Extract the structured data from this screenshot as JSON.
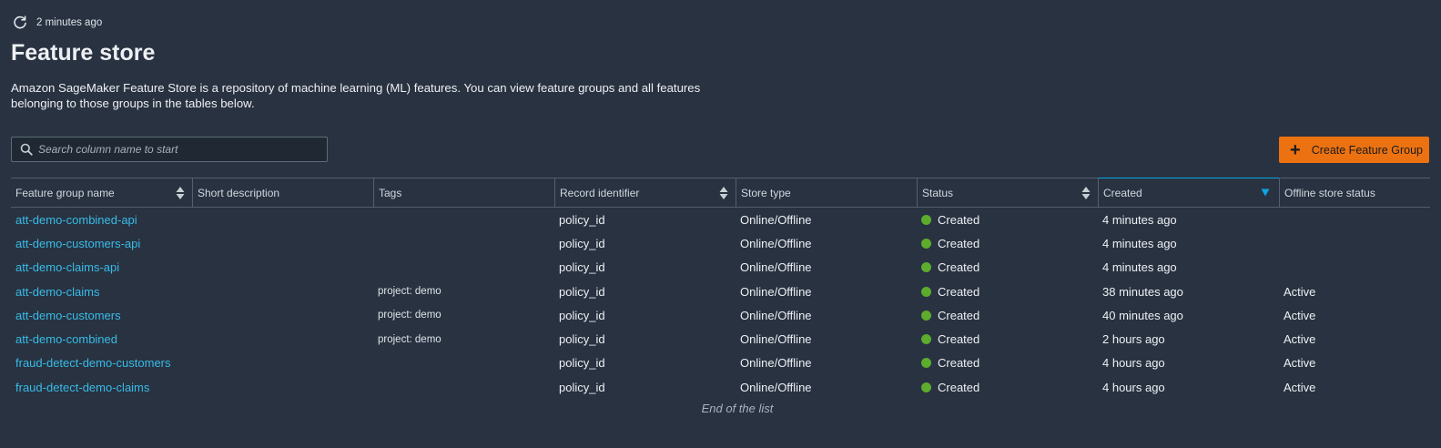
{
  "refresh": {
    "label": "2 minutes ago",
    "icon": "refresh-icon"
  },
  "page": {
    "title": "Feature store",
    "description": "Amazon SageMaker Feature Store is a repository of machine learning (ML) features. You can view feature groups and all features belonging to those groups in the tables below."
  },
  "search": {
    "placeholder": "Search column name to start",
    "value": "",
    "icon": "search-icon"
  },
  "create_button": {
    "label": "Create Feature Group",
    "icon": "plus-icon",
    "color": "#ec7211"
  },
  "table": {
    "columns": [
      "Feature group name",
      "Short description",
      "Tags",
      "Record identifier",
      "Store type",
      "Status",
      "Created",
      "Offline store status"
    ],
    "sorted_column": "Created",
    "sort_direction": "descending",
    "rows": [
      {
        "name": "att-demo-combined-api",
        "description": "",
        "tags": "",
        "record_identifier": "policy_id",
        "store_type": "Online/Offline",
        "status": "Created",
        "created": "4 minutes ago",
        "offline_status": ""
      },
      {
        "name": "att-demo-customers-api",
        "description": "",
        "tags": "",
        "record_identifier": "policy_id",
        "store_type": "Online/Offline",
        "status": "Created",
        "created": "4 minutes ago",
        "offline_status": ""
      },
      {
        "name": "att-demo-claims-api",
        "description": "",
        "tags": "",
        "record_identifier": "policy_id",
        "store_type": "Online/Offline",
        "status": "Created",
        "created": "4 minutes ago",
        "offline_status": ""
      },
      {
        "name": "att-demo-claims",
        "description": "",
        "tags": "project: demo",
        "record_identifier": "policy_id",
        "store_type": "Online/Offline",
        "status": "Created",
        "created": "38 minutes ago",
        "offline_status": "Active"
      },
      {
        "name": "att-demo-customers",
        "description": "",
        "tags": "project: demo",
        "record_identifier": "policy_id",
        "store_type": "Online/Offline",
        "status": "Created",
        "created": "40 minutes ago",
        "offline_status": "Active"
      },
      {
        "name": "att-demo-combined",
        "description": "",
        "tags": "project: demo",
        "record_identifier": "policy_id",
        "store_type": "Online/Offline",
        "status": "Created",
        "created": "2 hours ago",
        "offline_status": "Active"
      },
      {
        "name": "fraud-detect-demo-customers",
        "description": "",
        "tags": "",
        "record_identifier": "policy_id",
        "store_type": "Online/Offline",
        "status": "Created",
        "created": "4 hours ago",
        "offline_status": "Active"
      },
      {
        "name": "fraud-detect-demo-claims",
        "description": "",
        "tags": "",
        "record_identifier": "policy_id",
        "store_type": "Online/Offline",
        "status": "Created",
        "created": "4 hours ago",
        "offline_status": "Active"
      }
    ],
    "end_label": "End of the list"
  },
  "colors": {
    "background": "#283241",
    "link": "#39bbe6",
    "status_created": "#5dac2e",
    "sort_active": "#0ea4e3"
  }
}
